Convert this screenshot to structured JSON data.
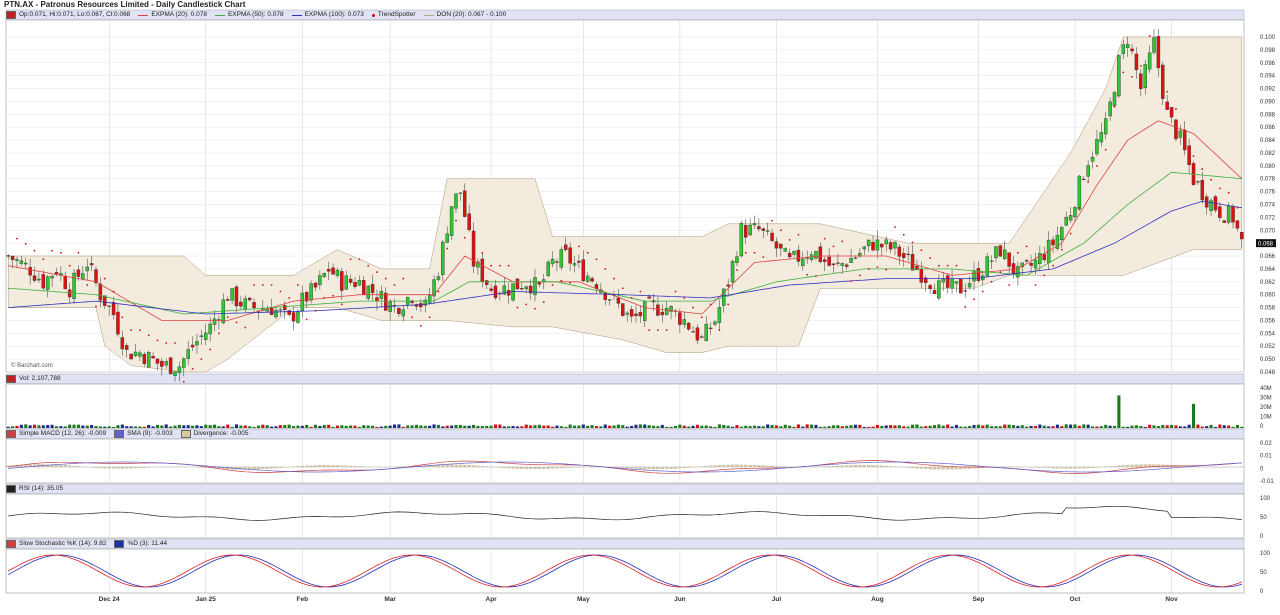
{
  "title": "PTN.AX - Patronus Resources Limited - Daily Candlestick Chart",
  "legend": {
    "ohlc": "Op:0.071, Hi:0.071, Lo:0.067, Cl:0.068",
    "expma20": "EXPMA (20): 0.078",
    "expma50": "EXPMA (50): 0.078",
    "expma100": "EXPMA (100): 0.073",
    "trendspotter": "TrendSpotter",
    "don": "DON (20): 0.067 - 0.100",
    "volume": "Vol: 2,107,788",
    "macd": "Simple MACD (12, 26): -0.009",
    "macd_sma": "SMA (9): -0.003",
    "macd_div": "Divergence: -0.005",
    "rsi": "RSI (14): 35.05",
    "stoch_k": "Slow Stochastic %K (14): 9.82",
    "stoch_d": "%D (3): 11.44"
  },
  "watermark": "© Barchart.com",
  "last_price_label": "0.068",
  "colors": {
    "up": "#2fc72f",
    "down": "#e01010",
    "expma20": "#e04040",
    "expma50": "#40b040",
    "expma100": "#3030c0",
    "donchian_fill": "#f3ebdd",
    "trendspotter": "#d01010",
    "panel_bg": "#dfe3f3",
    "grid": "#e4e4e4"
  },
  "chart_data": {
    "type": "candlestick",
    "x_labels": [
      "Dec 24",
      "Jan 25",
      "Feb",
      "Mar",
      "Apr",
      "May",
      "Jun",
      "Jul",
      "Aug",
      "Sep",
      "Oct",
      "Nov"
    ],
    "price_axis": {
      "ylim": [
        0.048,
        0.1
      ],
      "ticks": [
        "0.100",
        "0.098",
        "0.096",
        "0.094",
        "0.092",
        "0.090",
        "0.088",
        "0.086",
        "0.084",
        "0.082",
        "0.080",
        "0.078",
        "0.076",
        "0.074",
        "0.072",
        "0.070",
        "0.068",
        "0.066",
        "0.064",
        "0.062",
        "0.060",
        "0.058",
        "0.056",
        "0.054",
        "0.052",
        "0.050",
        "0.048"
      ]
    },
    "price_path": [
      [
        0,
        0.066
      ],
      [
        5,
        0.064
      ],
      [
        8,
        0.062
      ],
      [
        11,
        0.064
      ],
      [
        14,
        0.061
      ],
      [
        18,
        0.065
      ],
      [
        21,
        0.06
      ],
      [
        24,
        0.057
      ],
      [
        27,
        0.051
      ],
      [
        30,
        0.051
      ],
      [
        35,
        0.049
      ],
      [
        39,
        0.049
      ],
      [
        42,
        0.052
      ],
      [
        46,
        0.055
      ],
      [
        50,
        0.06
      ],
      [
        55,
        0.058
      ],
      [
        60,
        0.058
      ],
      [
        64,
        0.056
      ],
      [
        67,
        0.059
      ],
      [
        70,
        0.061
      ],
      [
        73,
        0.064
      ],
      [
        76,
        0.062
      ],
      [
        80,
        0.062
      ],
      [
        84,
        0.06
      ],
      [
        88,
        0.058
      ],
      [
        92,
        0.06
      ],
      [
        95,
        0.058
      ],
      [
        98,
        0.064
      ],
      [
        101,
        0.074
      ],
      [
        103,
        0.076
      ],
      [
        106,
        0.065
      ],
      [
        110,
        0.061
      ],
      [
        114,
        0.061
      ],
      [
        118,
        0.062
      ],
      [
        121,
        0.061
      ],
      [
        124,
        0.065
      ],
      [
        127,
        0.066
      ],
      [
        130,
        0.064
      ],
      [
        134,
        0.062
      ],
      [
        138,
        0.059
      ],
      [
        142,
        0.056
      ],
      [
        146,
        0.058
      ],
      [
        150,
        0.058
      ],
      [
        154,
        0.056
      ],
      [
        158,
        0.053
      ],
      [
        161,
        0.056
      ],
      [
        164,
        0.062
      ],
      [
        167,
        0.07
      ],
      [
        171,
        0.07
      ],
      [
        174,
        0.068
      ],
      [
        178,
        0.065
      ],
      [
        183,
        0.067
      ],
      [
        188,
        0.064
      ],
      [
        193,
        0.066
      ],
      [
        197,
        0.068
      ],
      [
        202,
        0.067
      ],
      [
        207,
        0.064
      ],
      [
        212,
        0.061
      ],
      [
        217,
        0.061
      ],
      [
        222,
        0.064
      ],
      [
        226,
        0.067
      ],
      [
        230,
        0.063
      ],
      [
        234,
        0.065
      ],
      [
        238,
        0.068
      ],
      [
        242,
        0.073
      ],
      [
        246,
        0.081
      ],
      [
        250,
        0.086
      ],
      [
        253,
        0.096
      ],
      [
        255,
        0.1
      ],
      [
        258,
        0.092
      ],
      [
        261,
        0.099
      ],
      [
        264,
        0.088
      ],
      [
        267,
        0.084
      ],
      [
        270,
        0.078
      ],
      [
        273,
        0.075
      ],
      [
        276,
        0.073
      ],
      [
        279,
        0.072
      ],
      [
        281,
        0.068
      ]
    ],
    "n_bars": 282,
    "ema20": [
      [
        0,
        0.0645
      ],
      [
        20,
        0.062
      ],
      [
        35,
        0.056
      ],
      [
        50,
        0.056
      ],
      [
        65,
        0.059
      ],
      [
        80,
        0.06
      ],
      [
        97,
        0.06
      ],
      [
        104,
        0.066
      ],
      [
        115,
        0.062
      ],
      [
        130,
        0.062
      ],
      [
        145,
        0.058
      ],
      [
        158,
        0.057
      ],
      [
        170,
        0.065
      ],
      [
        185,
        0.066
      ],
      [
        200,
        0.066
      ],
      [
        215,
        0.063
      ],
      [
        230,
        0.064
      ],
      [
        240,
        0.068
      ],
      [
        248,
        0.077
      ],
      [
        255,
        0.084
      ],
      [
        262,
        0.087
      ],
      [
        270,
        0.085
      ],
      [
        281,
        0.078
      ]
    ],
    "ema50": [
      [
        0,
        0.061
      ],
      [
        20,
        0.06
      ],
      [
        40,
        0.057
      ],
      [
        60,
        0.058
      ],
      [
        80,
        0.059
      ],
      [
        97,
        0.059
      ],
      [
        105,
        0.062
      ],
      [
        125,
        0.062
      ],
      [
        145,
        0.059
      ],
      [
        160,
        0.059
      ],
      [
        175,
        0.062
      ],
      [
        195,
        0.064
      ],
      [
        215,
        0.064
      ],
      [
        232,
        0.063
      ],
      [
        245,
        0.068
      ],
      [
        255,
        0.074
      ],
      [
        265,
        0.079
      ],
      [
        281,
        0.078
      ]
    ],
    "ema100": [
      [
        0,
        0.058
      ],
      [
        20,
        0.059
      ],
      [
        45,
        0.057
      ],
      [
        70,
        0.0575
      ],
      [
        95,
        0.0585
      ],
      [
        115,
        0.0605
      ],
      [
        140,
        0.06
      ],
      [
        160,
        0.0595
      ],
      [
        178,
        0.0615
      ],
      [
        200,
        0.0625
      ],
      [
        220,
        0.0625
      ],
      [
        238,
        0.064
      ],
      [
        252,
        0.068
      ],
      [
        265,
        0.073
      ],
      [
        272,
        0.0745
      ],
      [
        281,
        0.0735
      ]
    ],
    "donchian": [
      [
        0,
        0.066,
        0.058
      ],
      [
        20,
        0.066,
        0.058
      ],
      [
        22,
        0.066,
        0.052
      ],
      [
        28,
        0.066,
        0.049
      ],
      [
        40,
        0.066,
        0.048
      ],
      [
        45,
        0.063,
        0.048
      ],
      [
        50,
        0.063,
        0.05
      ],
      [
        65,
        0.063,
        0.058
      ],
      [
        75,
        0.067,
        0.058
      ],
      [
        85,
        0.064,
        0.056
      ],
      [
        96,
        0.064,
        0.056
      ],
      [
        100,
        0.078,
        0.056
      ],
      [
        115,
        0.078,
        0.055
      ],
      [
        120,
        0.078,
        0.055
      ],
      [
        124,
        0.069,
        0.055
      ],
      [
        140,
        0.069,
        0.053
      ],
      [
        150,
        0.069,
        0.051
      ],
      [
        158,
        0.069,
        0.051
      ],
      [
        164,
        0.071,
        0.052
      ],
      [
        180,
        0.071,
        0.052
      ],
      [
        185,
        0.071,
        0.061
      ],
      [
        205,
        0.068,
        0.061
      ],
      [
        215,
        0.068,
        0.061
      ],
      [
        220,
        0.068,
        0.061
      ],
      [
        228,
        0.068,
        0.063
      ],
      [
        242,
        0.082,
        0.063
      ],
      [
        250,
        0.092,
        0.063
      ],
      [
        254,
        0.1,
        0.063
      ],
      [
        270,
        0.1,
        0.067
      ],
      [
        281,
        0.1,
        0.067
      ]
    ],
    "volume_axis": {
      "ylim": [
        0,
        40
      ],
      "unit": "M",
      "ticks": [
        "40M",
        "30M",
        "20M",
        "10M",
        "0"
      ]
    },
    "volume_spikes": [
      [
        253,
        31
      ],
      [
        270,
        23
      ]
    ],
    "macd_axis": {
      "ylim": [
        -0.01,
        0.02
      ],
      "ticks": [
        "0.02",
        "0.01",
        "0",
        "-0.01"
      ]
    },
    "rsi_axis": {
      "ylim": [
        0,
        100
      ],
      "ticks": [
        "100",
        "50",
        "0"
      ]
    },
    "stoch_axis": {
      "ylim": [
        0,
        100
      ],
      "ticks": [
        "100",
        "50",
        "0"
      ]
    }
  }
}
